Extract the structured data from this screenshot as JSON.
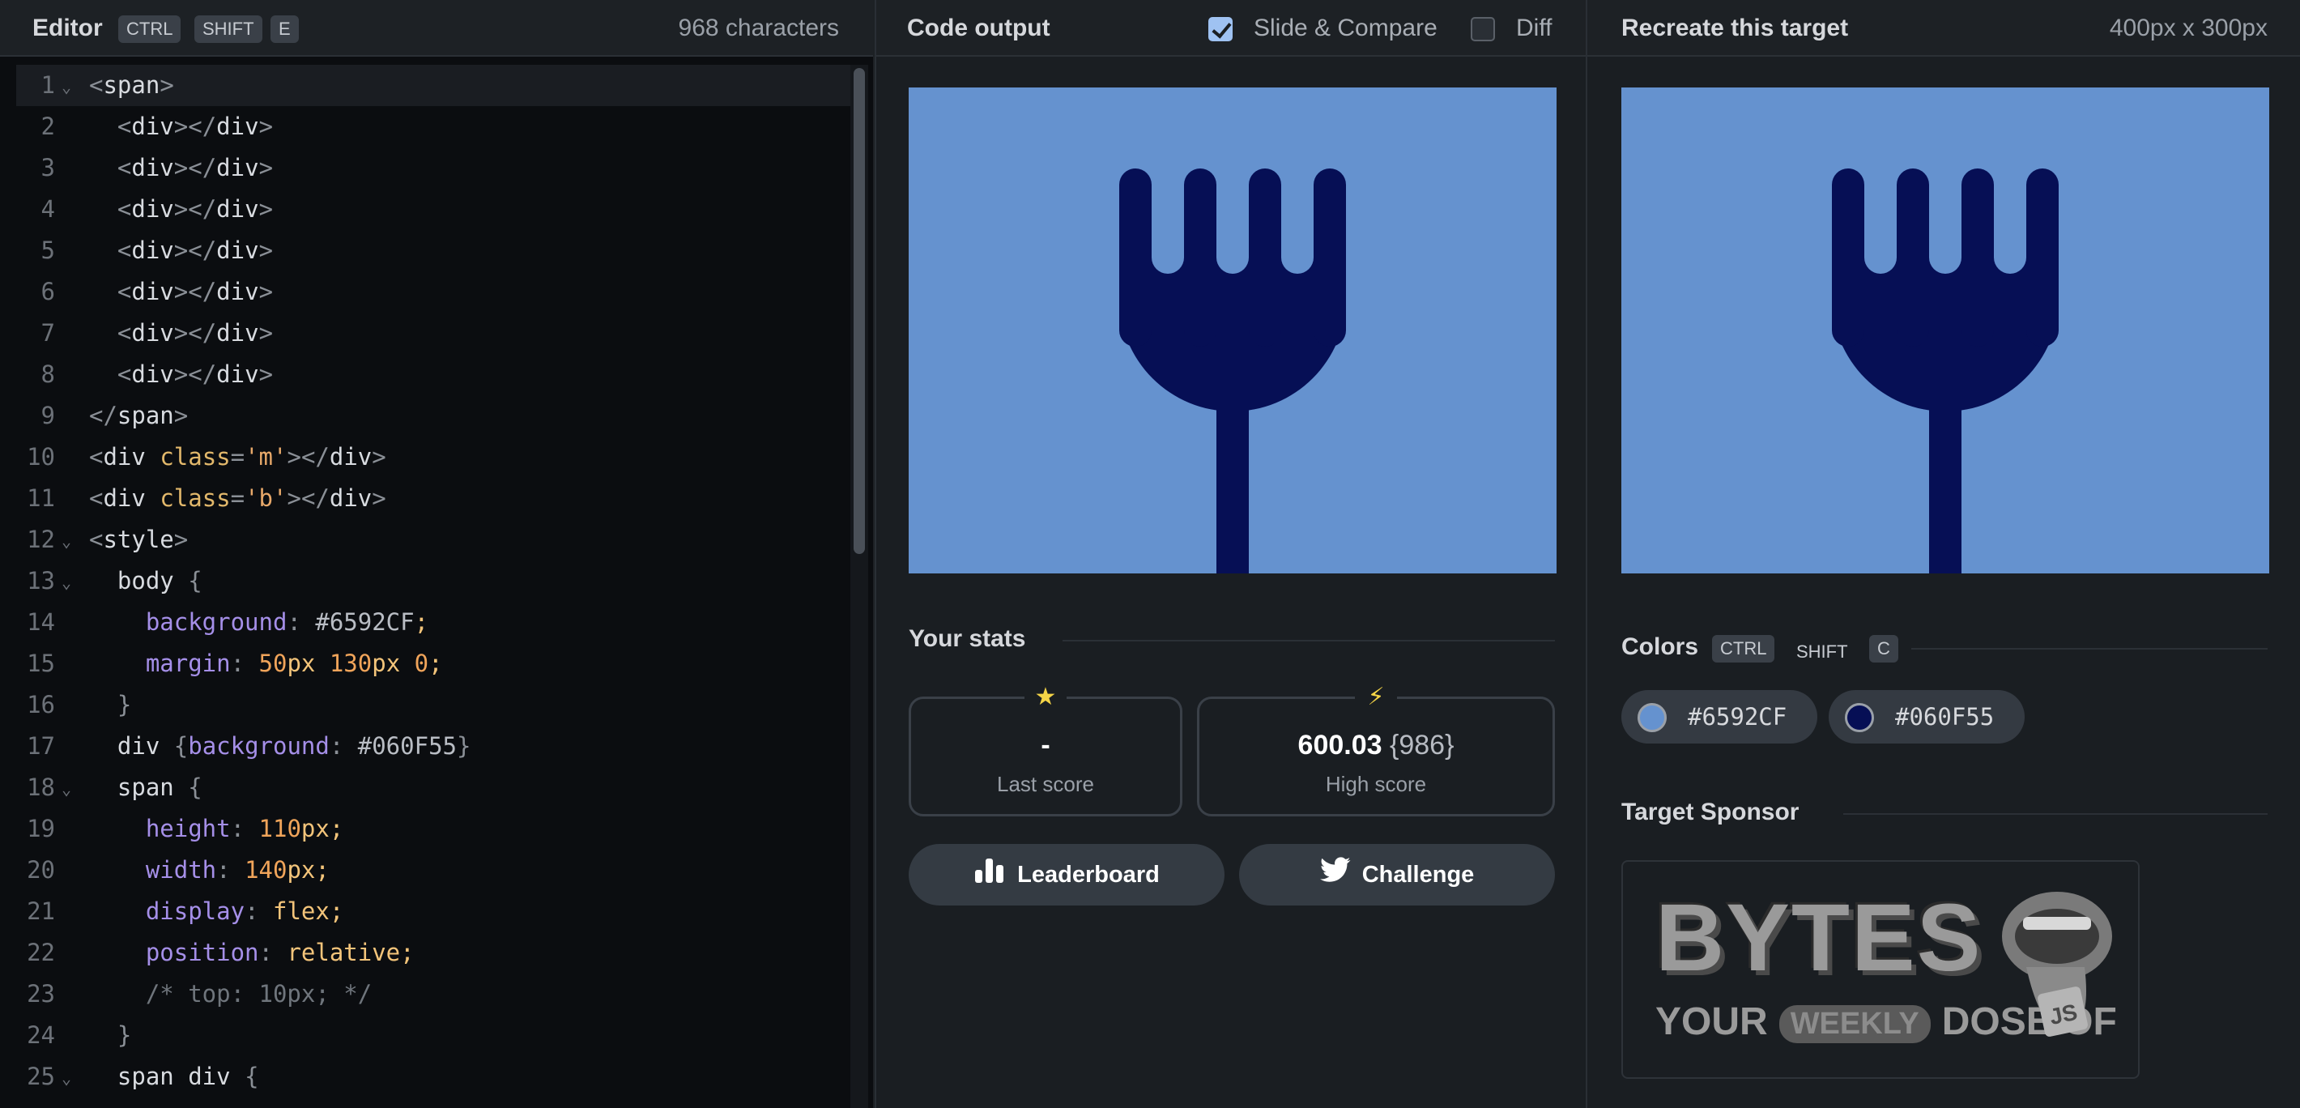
{
  "editor": {
    "title": "Editor",
    "shortcut": [
      "CTRL",
      "SHIFT",
      "E"
    ],
    "char_count": "968 characters",
    "lines": [
      {
        "n": "1",
        "fold": true,
        "active": true,
        "parts": [
          [
            "t-punc",
            "<"
          ],
          [
            "t-tag",
            "span"
          ],
          [
            "t-punc",
            ">"
          ]
        ]
      },
      {
        "n": "2",
        "parts": [
          [
            "t-punc",
            "  <"
          ],
          [
            "t-tag",
            "div"
          ],
          [
            "t-punc",
            "></"
          ],
          [
            "t-tag",
            "div"
          ],
          [
            "t-punc",
            ">"
          ]
        ]
      },
      {
        "n": "3",
        "parts": [
          [
            "t-punc",
            "  <"
          ],
          [
            "t-tag",
            "div"
          ],
          [
            "t-punc",
            "></"
          ],
          [
            "t-tag",
            "div"
          ],
          [
            "t-punc",
            ">"
          ]
        ]
      },
      {
        "n": "4",
        "parts": [
          [
            "t-punc",
            "  <"
          ],
          [
            "t-tag",
            "div"
          ],
          [
            "t-punc",
            "></"
          ],
          [
            "t-tag",
            "div"
          ],
          [
            "t-punc",
            ">"
          ]
        ]
      },
      {
        "n": "5",
        "parts": [
          [
            "t-punc",
            "  <"
          ],
          [
            "t-tag",
            "div"
          ],
          [
            "t-punc",
            "></"
          ],
          [
            "t-tag",
            "div"
          ],
          [
            "t-punc",
            ">"
          ]
        ]
      },
      {
        "n": "6",
        "parts": [
          [
            "t-punc",
            "  <"
          ],
          [
            "t-tag",
            "div"
          ],
          [
            "t-punc",
            "></"
          ],
          [
            "t-tag",
            "div"
          ],
          [
            "t-punc",
            ">"
          ]
        ]
      },
      {
        "n": "7",
        "parts": [
          [
            "t-punc",
            "  <"
          ],
          [
            "t-tag",
            "div"
          ],
          [
            "t-punc",
            "></"
          ],
          [
            "t-tag",
            "div"
          ],
          [
            "t-punc",
            ">"
          ]
        ]
      },
      {
        "n": "8",
        "parts": [
          [
            "t-punc",
            "  <"
          ],
          [
            "t-tag",
            "div"
          ],
          [
            "t-punc",
            "></"
          ],
          [
            "t-tag",
            "div"
          ],
          [
            "t-punc",
            ">"
          ]
        ]
      },
      {
        "n": "9",
        "parts": [
          [
            "t-punc",
            "</"
          ],
          [
            "t-tag",
            "span"
          ],
          [
            "t-punc",
            ">"
          ]
        ]
      },
      {
        "n": "10",
        "parts": [
          [
            "t-punc",
            "<"
          ],
          [
            "t-tag",
            "div "
          ],
          [
            "t-attr",
            "class"
          ],
          [
            "t-punc",
            "="
          ],
          [
            "t-str",
            "'m'"
          ],
          [
            "t-punc",
            "></"
          ],
          [
            "t-tag",
            "div"
          ],
          [
            "t-punc",
            ">"
          ]
        ]
      },
      {
        "n": "11",
        "parts": [
          [
            "t-punc",
            "<"
          ],
          [
            "t-tag",
            "div "
          ],
          [
            "t-attr",
            "class"
          ],
          [
            "t-punc",
            "="
          ],
          [
            "t-str",
            "'b'"
          ],
          [
            "t-punc",
            "></"
          ],
          [
            "t-tag",
            "div"
          ],
          [
            "t-punc",
            ">"
          ]
        ]
      },
      {
        "n": "12",
        "fold": true,
        "parts": [
          [
            "t-punc",
            "<"
          ],
          [
            "t-tag",
            "style"
          ],
          [
            "t-punc",
            ">"
          ]
        ]
      },
      {
        "n": "13",
        "fold": true,
        "parts": [
          [
            "t-sel",
            "  body "
          ],
          [
            "t-punc",
            "{"
          ]
        ]
      },
      {
        "n": "14",
        "parts": [
          [
            "t-prop",
            "    background"
          ],
          [
            "t-punc",
            ": "
          ],
          [
            "t-hex",
            "#6592CF"
          ],
          [
            "t-val",
            ";"
          ]
        ]
      },
      {
        "n": "15",
        "parts": [
          [
            "t-prop",
            "    margin"
          ],
          [
            "t-punc",
            ": "
          ],
          [
            "t-num",
            "50"
          ],
          [
            "t-val",
            "px "
          ],
          [
            "t-num",
            "130"
          ],
          [
            "t-val",
            "px "
          ],
          [
            "t-num",
            "0"
          ],
          [
            "t-val",
            ";"
          ]
        ]
      },
      {
        "n": "16",
        "parts": [
          [
            "t-punc",
            "  }"
          ]
        ]
      },
      {
        "n": "17",
        "parts": [
          [
            "t-sel",
            "  div "
          ],
          [
            "t-punc",
            "{"
          ],
          [
            "t-prop",
            "background"
          ],
          [
            "t-punc",
            ": "
          ],
          [
            "t-hex",
            "#060F55"
          ],
          [
            "t-punc",
            "}"
          ]
        ]
      },
      {
        "n": "18",
        "fold": true,
        "parts": [
          [
            "t-sel",
            "  span "
          ],
          [
            "t-punc",
            "{"
          ]
        ]
      },
      {
        "n": "19",
        "parts": [
          [
            "t-prop",
            "    height"
          ],
          [
            "t-punc",
            ": "
          ],
          [
            "t-num",
            "110"
          ],
          [
            "t-val",
            "px;"
          ]
        ]
      },
      {
        "n": "20",
        "parts": [
          [
            "t-prop",
            "    width"
          ],
          [
            "t-punc",
            ": "
          ],
          [
            "t-num",
            "140"
          ],
          [
            "t-val",
            "px;"
          ]
        ]
      },
      {
        "n": "21",
        "parts": [
          [
            "t-prop",
            "    display"
          ],
          [
            "t-punc",
            ": "
          ],
          [
            "t-val",
            "flex;"
          ]
        ]
      },
      {
        "n": "22",
        "parts": [
          [
            "t-prop",
            "    position"
          ],
          [
            "t-punc",
            ": "
          ],
          [
            "t-val",
            "relative;"
          ]
        ]
      },
      {
        "n": "23",
        "parts": [
          [
            "t-com",
            "    /* top: 10px; */"
          ]
        ]
      },
      {
        "n": "24",
        "parts": [
          [
            "t-punc",
            "  }"
          ]
        ]
      },
      {
        "n": "25",
        "fold": true,
        "parts": [
          [
            "t-sel",
            "  span div "
          ],
          [
            "t-punc",
            "{"
          ]
        ]
      }
    ]
  },
  "output": {
    "title": "Code output",
    "slide_compare_label": "Slide & Compare",
    "slide_compare_checked": true,
    "diff_label": "Diff",
    "diff_checked": false
  },
  "stats": {
    "title": "Your stats",
    "last_score": {
      "value": "-",
      "label": "Last score",
      "icon": "star-icon"
    },
    "high_score": {
      "value": "600.03",
      "sub": "{986}",
      "label": "High score",
      "icon": "bolt-icon"
    },
    "leaderboard_label": "Leaderboard",
    "challenge_label": "Challenge"
  },
  "target": {
    "title": "Recreate this target",
    "size": "400px x 300px",
    "colors_title": "Colors",
    "colors_shortcut": [
      "CTRL",
      "SHIFT",
      "C"
    ],
    "colors": [
      "#6592CF",
      "#060F55"
    ],
    "sponsor_title": "Target Sponsor",
    "sponsor": {
      "word": "BYTES",
      "tag_before": "YOUR",
      "tag_highlight": "WEEKLY",
      "tag_after": "DOSE OF",
      "badge": "JS"
    }
  },
  "theme": {
    "canvas_bg": "#6592CF",
    "fork_color": "#060F55",
    "star_color": "#f5d547",
    "bolt_color": "#f5d547"
  }
}
